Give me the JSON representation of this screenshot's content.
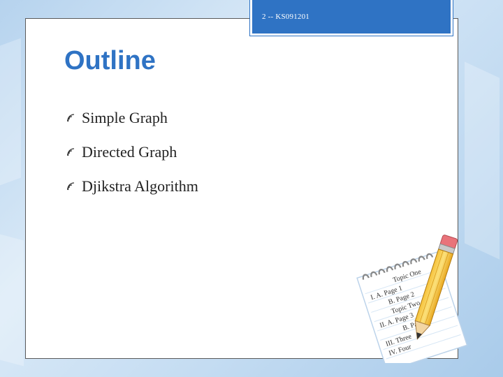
{
  "header": {
    "slide_label": "2 -- KS091201"
  },
  "title": "Outline",
  "bullets": [
    {
      "label": "Simple  Graph"
    },
    {
      "label": "Directed  Graph"
    },
    {
      "label": "Djikstra  Algorithm"
    }
  ],
  "notepad": {
    "lines": [
      "Topic One",
      "I.   A.   Page 1",
      "B.   Page 2",
      "Topic Two",
      "II.   A.   Page 3",
      "B.   Page 4",
      "III.  Three",
      "IV.  Four"
    ]
  },
  "colors": {
    "accent": "#2f73c4",
    "header_text": "#ffffff"
  }
}
